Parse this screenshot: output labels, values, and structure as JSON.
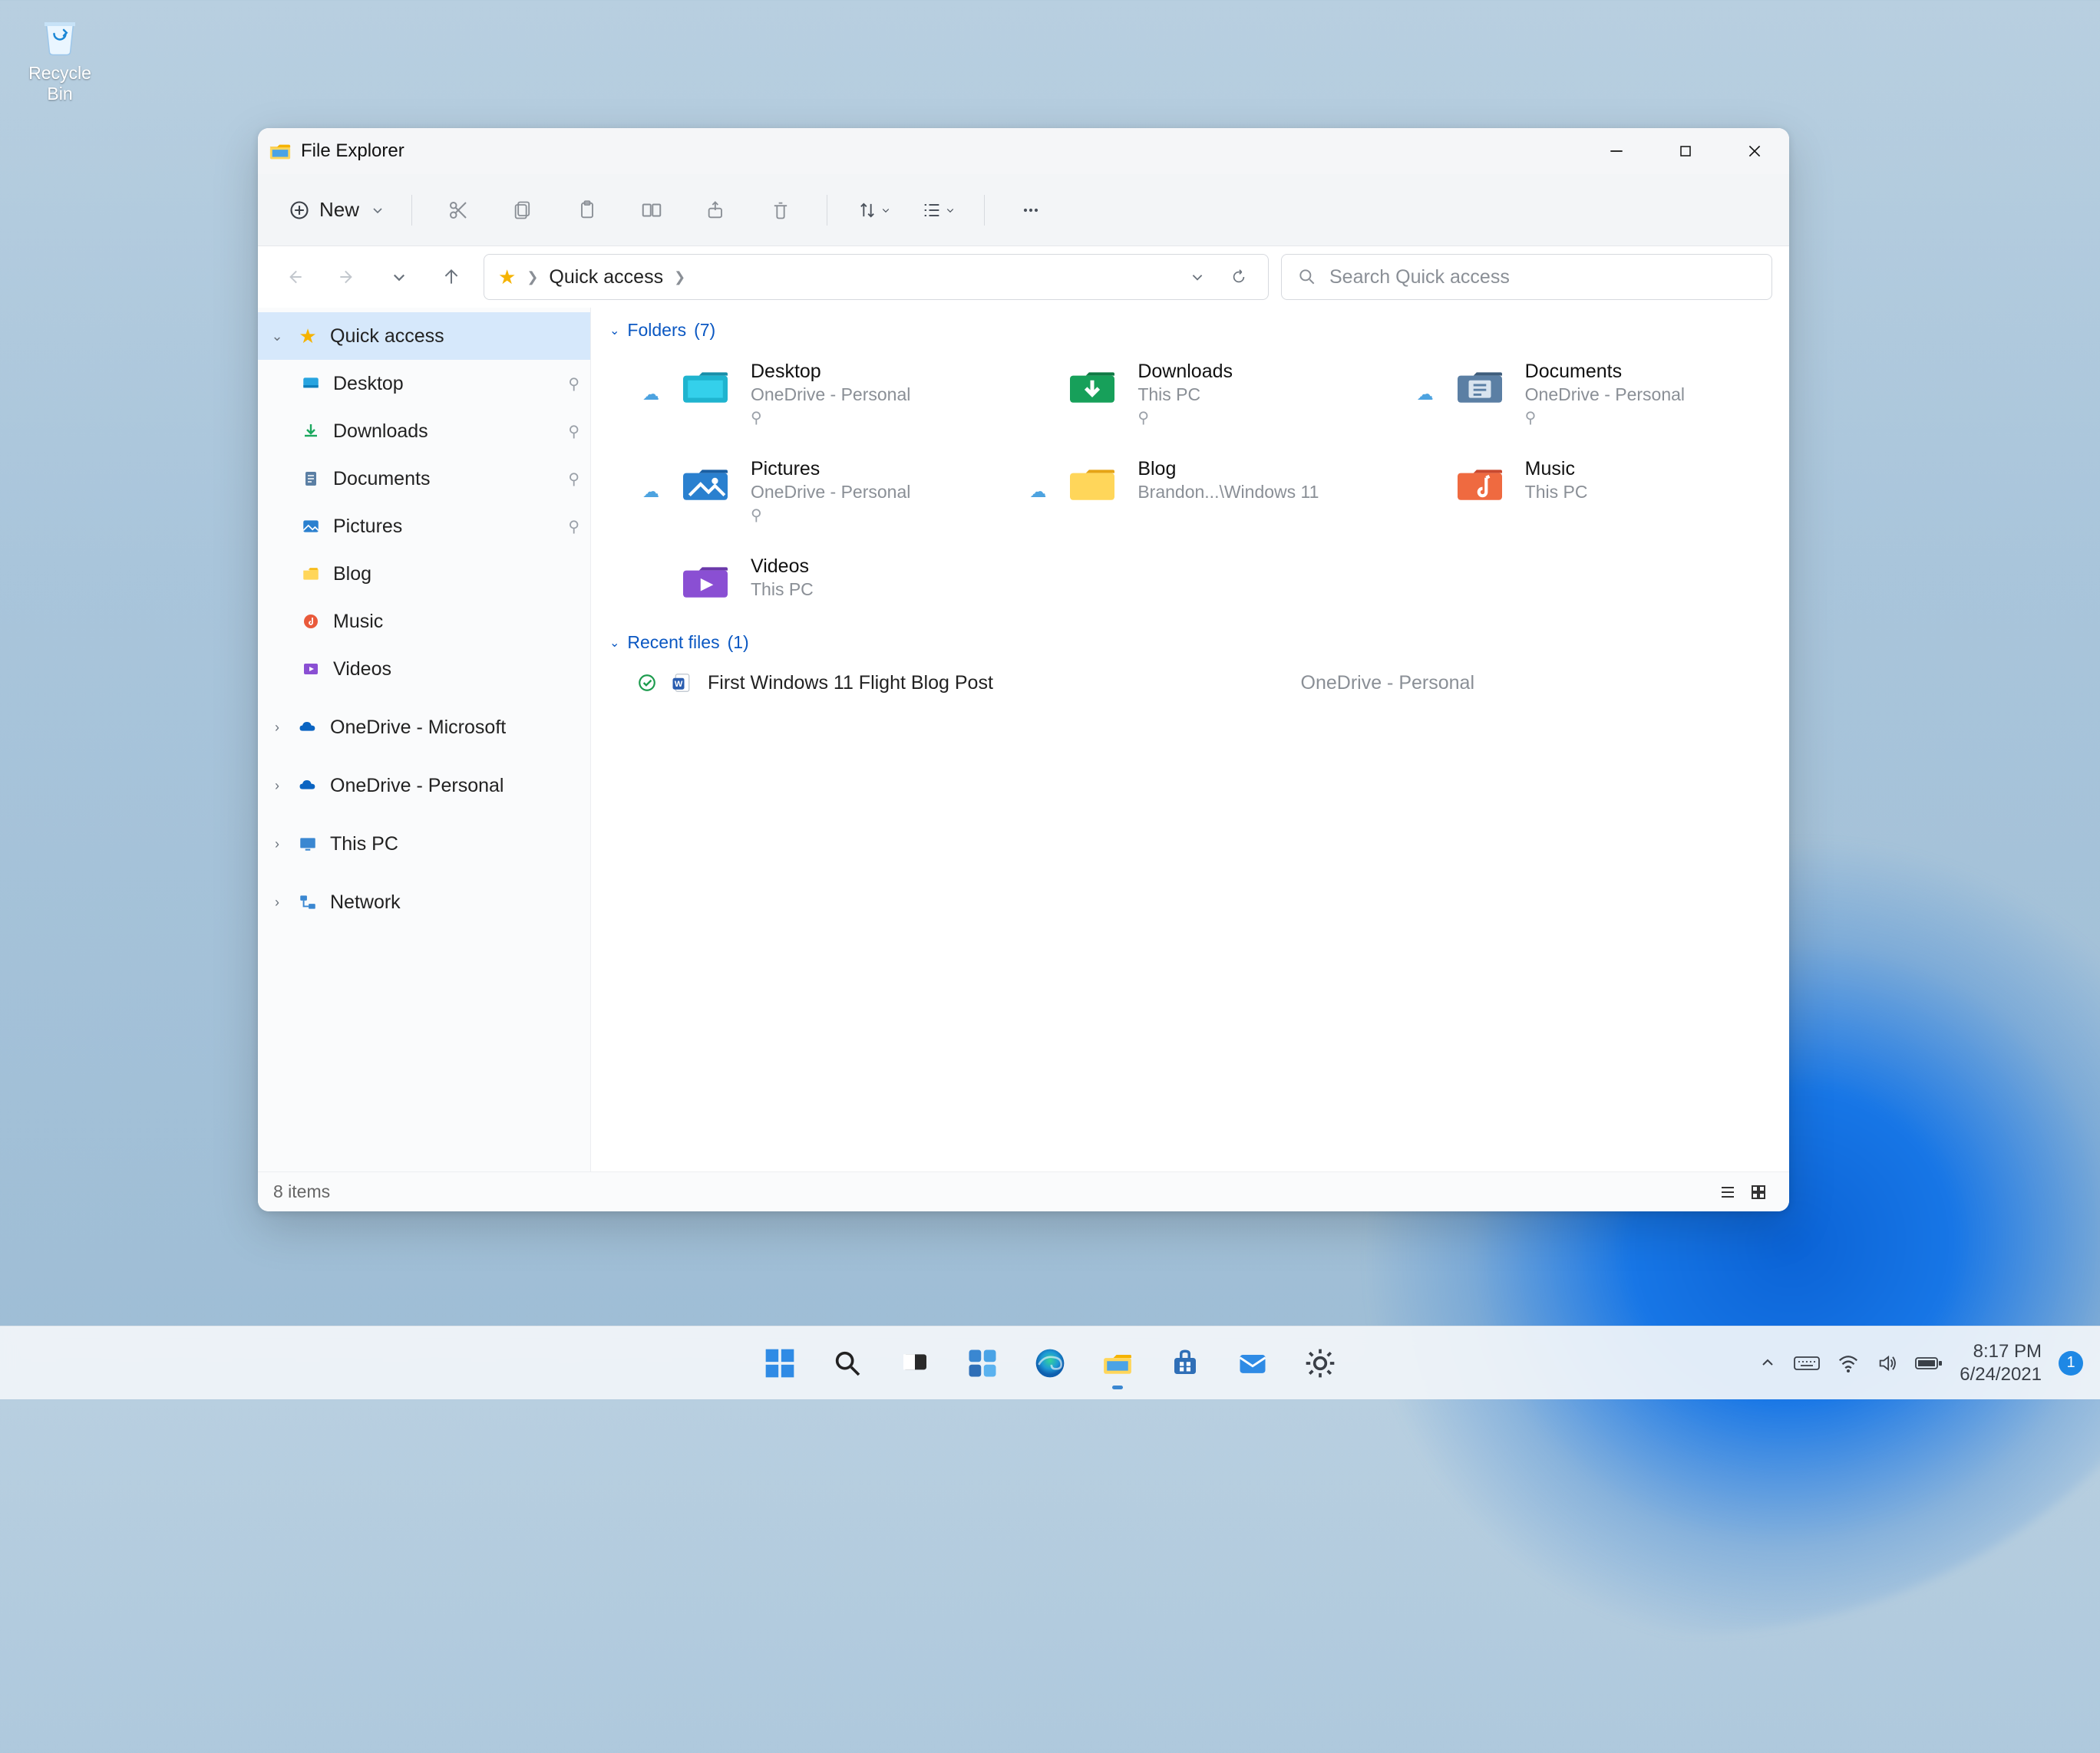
{
  "desktop": {
    "recycle_bin_label": "Recycle Bin"
  },
  "window": {
    "title": "File Explorer",
    "new_button": "New"
  },
  "address": {
    "crumb1": "Quick access"
  },
  "search": {
    "placeholder": "Search Quick access"
  },
  "sidebar": {
    "quick_access": "Quick access",
    "items": [
      {
        "label": "Desktop"
      },
      {
        "label": "Downloads"
      },
      {
        "label": "Documents"
      },
      {
        "label": "Pictures"
      },
      {
        "label": "Blog"
      },
      {
        "label": "Music"
      },
      {
        "label": "Videos"
      }
    ],
    "onedrive_ms": "OneDrive - Microsoft",
    "onedrive_personal": "OneDrive - Personal",
    "this_pc": "This PC",
    "network": "Network"
  },
  "sections": {
    "folders_label": "Folders",
    "folders_count": "(7)",
    "recent_label": "Recent files",
    "recent_count": "(1)"
  },
  "folders": [
    {
      "name": "Desktop",
      "sub": "OneDrive - Personal",
      "pinned": true,
      "cloud": true,
      "color": "teal",
      "kind": "desktop"
    },
    {
      "name": "Downloads",
      "sub": "This PC",
      "pinned": true,
      "cloud": false,
      "color": "green",
      "kind": "downloads"
    },
    {
      "name": "Documents",
      "sub": "OneDrive - Personal",
      "pinned": true,
      "cloud": true,
      "color": "blue",
      "kind": "documents"
    },
    {
      "name": "Pictures",
      "sub": "OneDrive - Personal",
      "pinned": true,
      "cloud": true,
      "color": "blue",
      "kind": "pictures"
    },
    {
      "name": "Blog",
      "sub": "Brandon...\\Windows 11",
      "pinned": false,
      "cloud": true,
      "color": "yellow",
      "kind": "folder"
    },
    {
      "name": "Music",
      "sub": "This PC",
      "pinned": false,
      "cloud": false,
      "color": "orange",
      "kind": "music"
    },
    {
      "name": "Videos",
      "sub": "This PC",
      "pinned": false,
      "cloud": false,
      "color": "purple",
      "kind": "videos"
    }
  ],
  "recent": [
    {
      "name": "First Windows 11 Flight Blog Post",
      "location": "OneDrive - Personal"
    }
  ],
  "status": {
    "items_text": "8 items"
  },
  "tray": {
    "time": "8:17 PM",
    "date": "6/24/2021",
    "badge": "1"
  }
}
